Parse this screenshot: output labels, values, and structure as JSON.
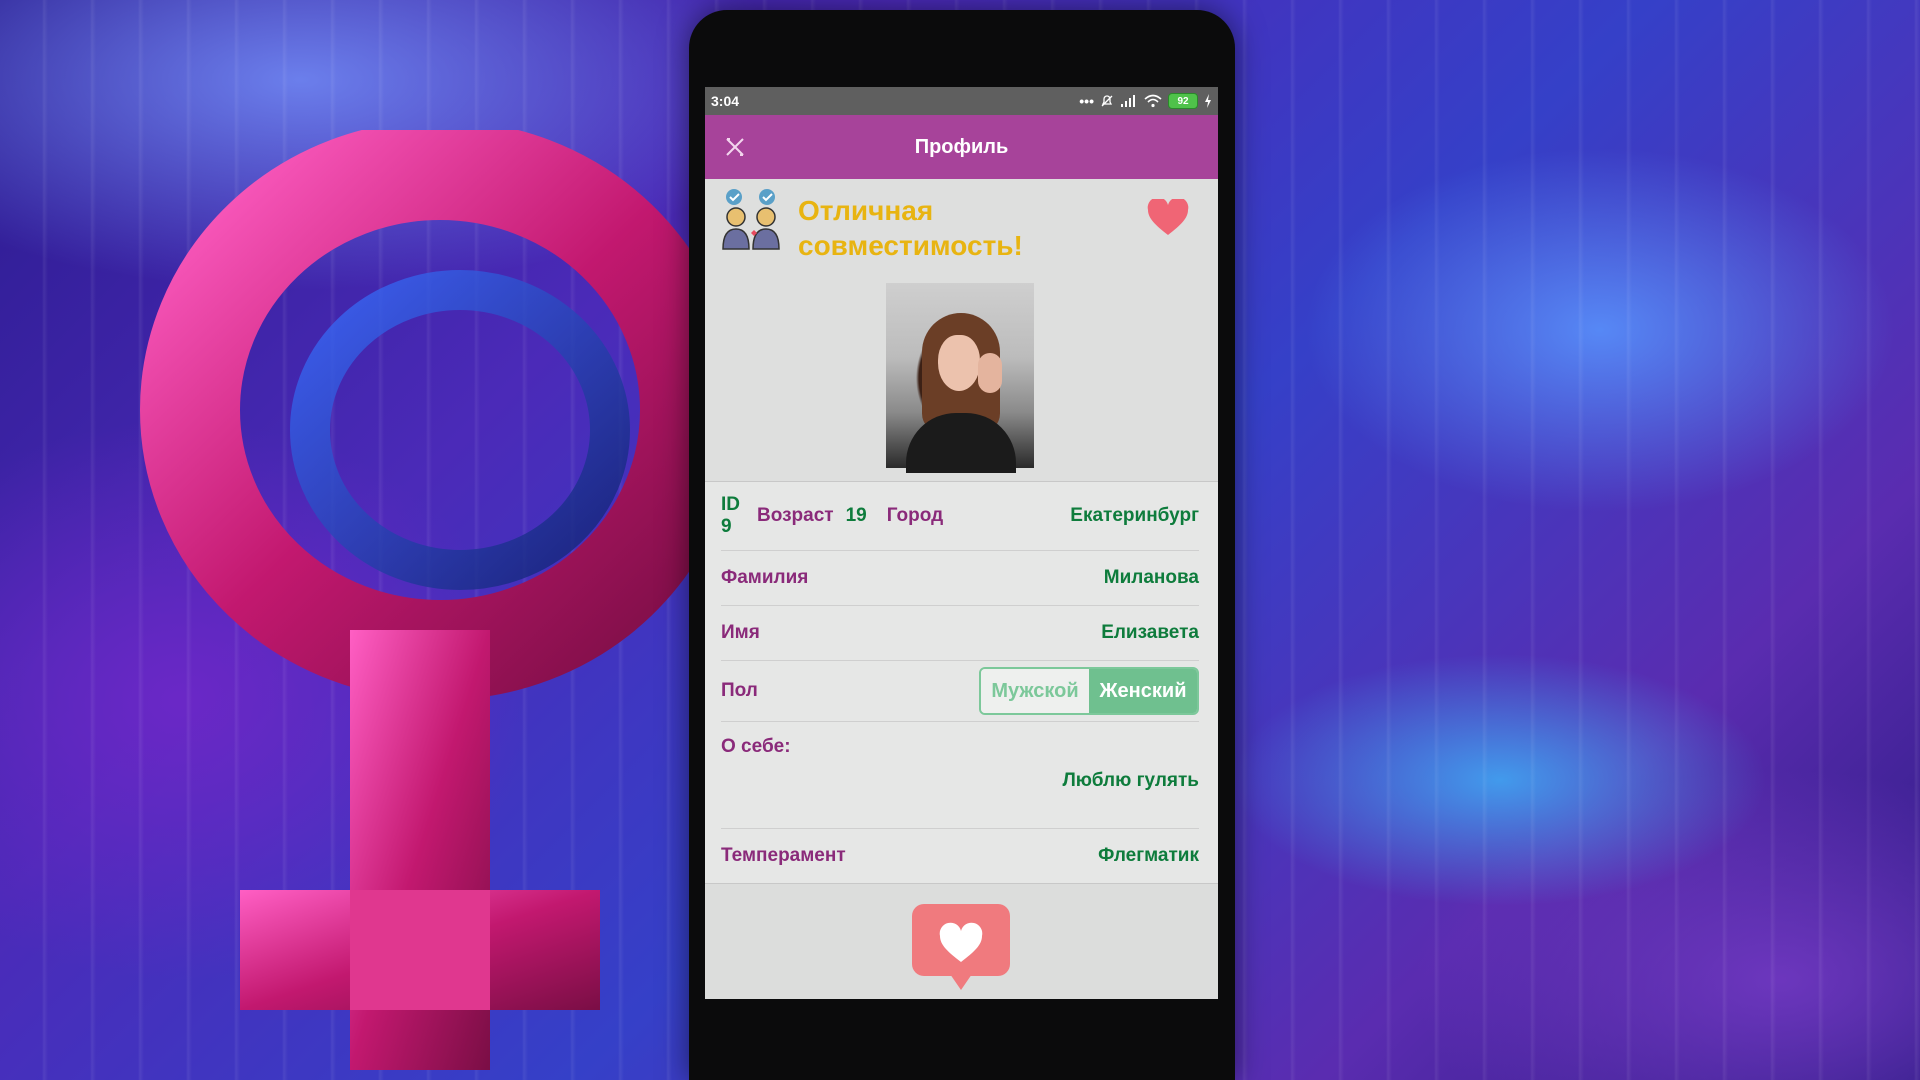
{
  "statusbar": {
    "time": "3:04",
    "battery": "92"
  },
  "appbar": {
    "title": "Профиль",
    "close_icon": "close-icon"
  },
  "profile": {
    "compat_icon": "couple-icon",
    "compat_line1": "Отличная",
    "compat_line2": "совместимость!",
    "favorite_icon": "heart-icon",
    "photo_icon": "profile-photo"
  },
  "fields": {
    "id_label": "ID",
    "id_value": "9",
    "age_label": "Возраст",
    "age_value": "19",
    "city_label": "Город",
    "city_value": "Екатеринбург",
    "surname_label": "Фамилия",
    "surname_value": "Миланова",
    "name_label": "Имя",
    "name_value": "Елизавета",
    "sex_label": "Пол",
    "sex_options": [
      "Мужской",
      "Женский"
    ],
    "sex_selected": "Женский",
    "about_label": "О себе:",
    "about_value": "Люблю гулять",
    "temperament_label": "Темперамент",
    "temperament_value": "Флегматик"
  },
  "bottom": {
    "like_icon": "like-heart-icon"
  },
  "colors": {
    "appbar": "#a7439a",
    "label": "#8a2a7a",
    "value": "#0e7c3c",
    "compat": "#e8b411",
    "heart": "#f06575",
    "segment_active": "#6fc08f"
  }
}
